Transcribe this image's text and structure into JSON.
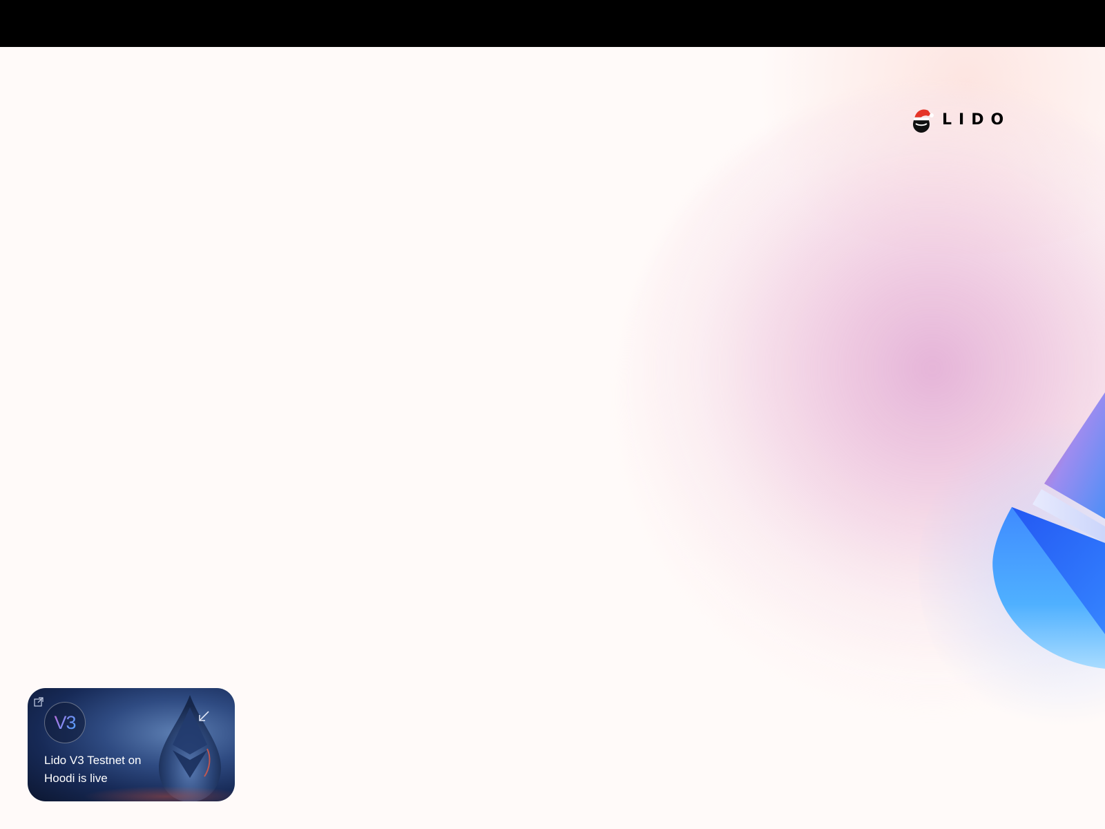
{
  "brand": {
    "name": "LIDO",
    "colors": {
      "top_bar": "#000000",
      "page_background": "#fffaf9",
      "hat_red": "#e53527",
      "card_navy": "#172a57"
    }
  },
  "header": {
    "logo_icon": "lido-drop-santa-hat-icon"
  },
  "promo": {
    "badge": "V3",
    "title": "Lido V3 Testnet on Hoodi is live",
    "icons": {
      "open": "external-link-icon",
      "collapse": "arrow-down-left-icon"
    }
  },
  "decor": {
    "hero_art": "ethereum-crystal-art"
  }
}
